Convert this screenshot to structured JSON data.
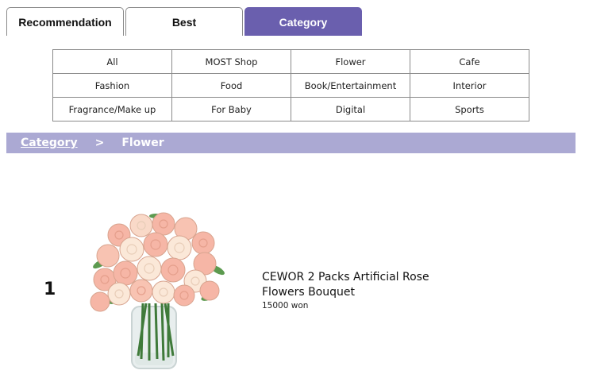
{
  "tabs": [
    {
      "label": "Recommendation",
      "active": false
    },
    {
      "label": "Best",
      "active": false
    },
    {
      "label": "Category",
      "active": true
    }
  ],
  "categories": [
    "All",
    "MOST Shop",
    "Flower",
    "Cafe",
    "Fashion",
    "Food",
    "Book/Entertainment",
    "Interior",
    "Fragrance/Make up",
    "For Baby",
    "Digital",
    "Sports"
  ],
  "breadcrumb": {
    "root": "Category",
    "separator": ">",
    "current": "Flower"
  },
  "products": [
    {
      "rank": "1",
      "name": "CEWOR 2 Packs Artificial Rose Flowers Bouquet",
      "price": "15000 won",
      "image": "rose-bouquet-in-glass-vase"
    }
  ],
  "colors": {
    "accent": "#6a5fae",
    "breadcrumb_bg": "#aba9d3",
    "border": "#8a8a8a"
  }
}
